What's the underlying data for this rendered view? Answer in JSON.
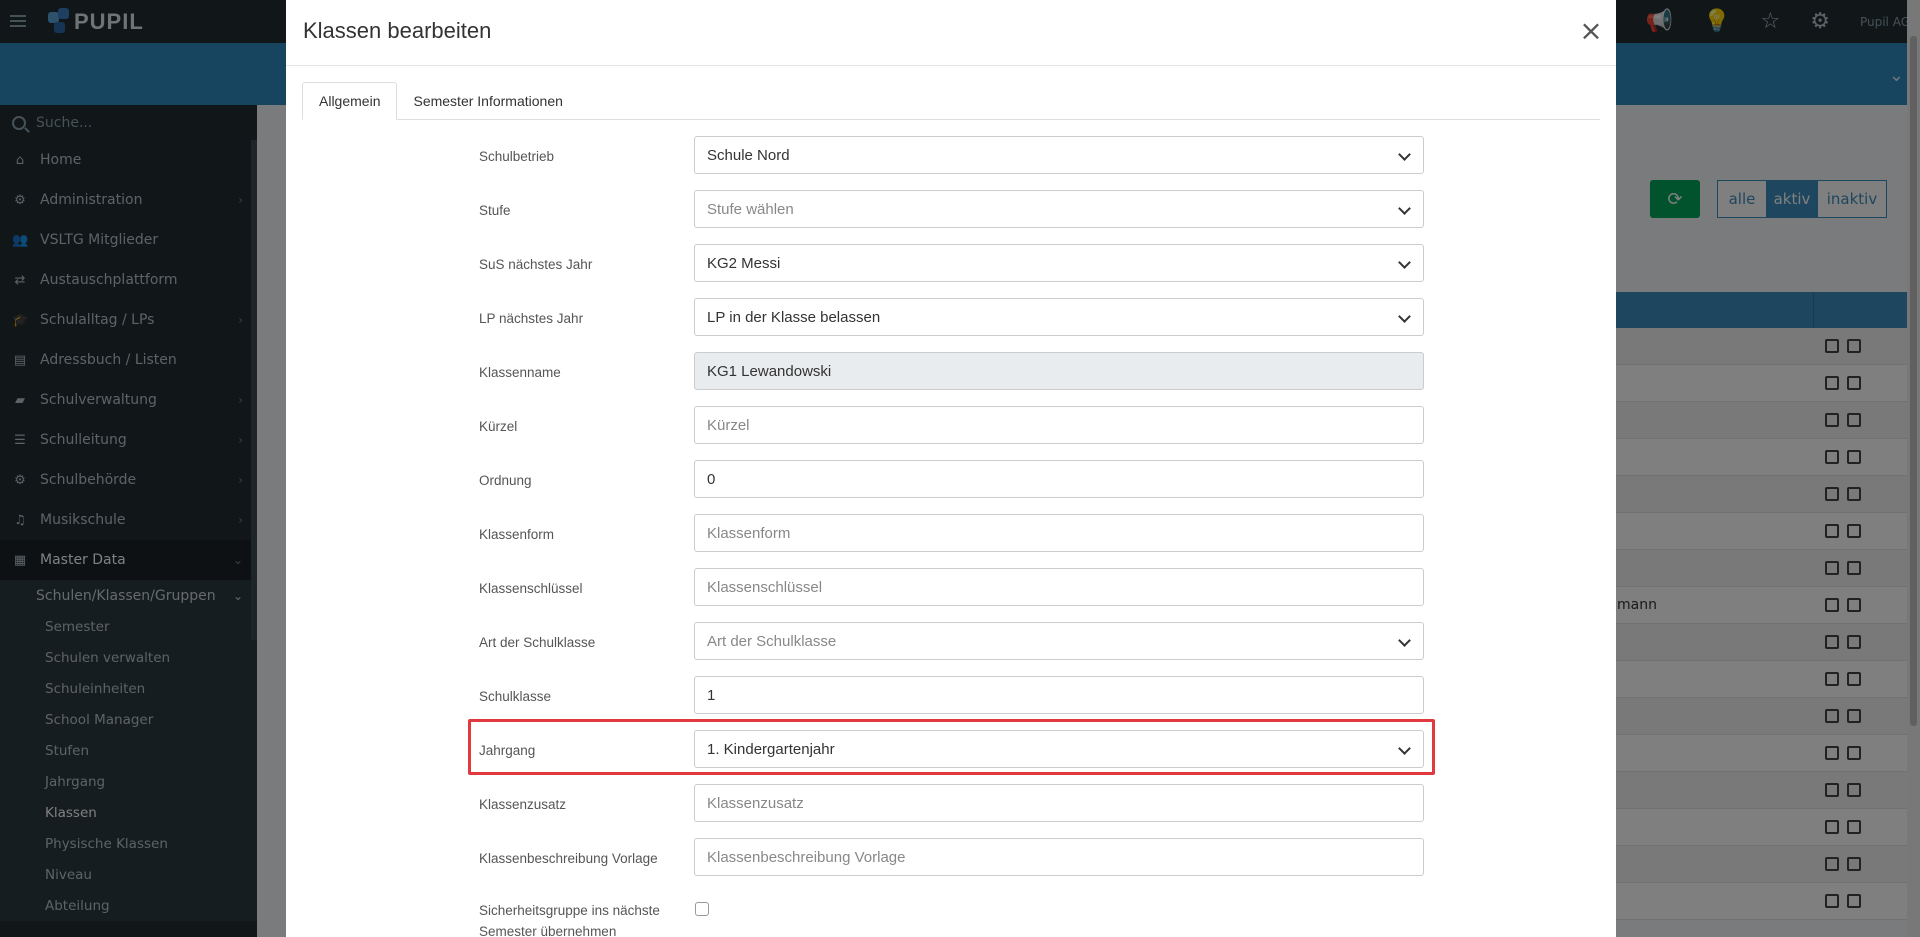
{
  "app": {
    "logo_text": "PUPIL",
    "user": "Pupil AG"
  },
  "sidebar": {
    "search_placeholder": "Suche...",
    "items": [
      {
        "label": "Home",
        "icon": "home-icon"
      },
      {
        "label": "Administration",
        "icon": "gears-icon"
      },
      {
        "label": "VSLTG Mitglieder",
        "icon": "users-icon"
      },
      {
        "label": "Austauschplattform",
        "icon": "exchange-icon"
      },
      {
        "label": "Schulalltag / LPs",
        "icon": "graduation-cap-icon"
      },
      {
        "label": "Adressbuch / Listen",
        "icon": "address-card-icon"
      },
      {
        "label": "Schulverwaltung",
        "icon": "folder-icon"
      },
      {
        "label": "Schulleitung",
        "icon": "signpost-icon"
      },
      {
        "label": "Schulbehörde",
        "icon": "cog-icon"
      },
      {
        "label": "Musikschule",
        "icon": "music-icon"
      },
      {
        "label": "Master Data",
        "icon": "database-icon"
      }
    ],
    "submenu_head": "Schulen/Klassen/Gruppen",
    "subitems": [
      "Semester",
      "Schulen verwalten",
      "Schuleinheiten",
      "School Manager",
      "Stufen",
      "Jahrgang",
      "Klassen",
      "Physische Klassen",
      "Niveau",
      "Abteilung"
    ]
  },
  "background": {
    "filter_buttons": [
      "alle",
      "aktiv",
      "inaktiv"
    ],
    "row_extra_text": "mann"
  },
  "modal": {
    "title": "Klassen bearbeiten",
    "tabs": [
      "Allgemein",
      "Semester Informationen"
    ],
    "fields": {
      "schulbetrieb": {
        "label": "Schulbetrieb",
        "value": "Schule Nord"
      },
      "stufe": {
        "label": "Stufe",
        "placeholder": "Stufe wählen"
      },
      "sus": {
        "label": "SuS nächstes Jahr",
        "value": "KG2 Messi"
      },
      "lp": {
        "label": "LP nächstes Jahr",
        "value": "LP in der Klasse belassen"
      },
      "klassenname": {
        "label": "Klassenname",
        "value": "KG1 Lewandowski"
      },
      "kuerzel": {
        "label": "Kürzel",
        "placeholder": "Kürzel"
      },
      "ordnung": {
        "label": "Ordnung",
        "value": "0"
      },
      "klassenform": {
        "label": "Klassenform",
        "placeholder": "Klassenform"
      },
      "klassenschluessel": {
        "label": "Klassenschlüssel",
        "placeholder": "Klassenschlüssel"
      },
      "art": {
        "label": "Art der Schulklasse",
        "placeholder": "Art der Schulklasse"
      },
      "schulklasse": {
        "label": "Schulklasse",
        "value": "1"
      },
      "jahrgang": {
        "label": "Jahrgang",
        "value": "1. Kindergartenjahr"
      },
      "klassenzusatz": {
        "label": "Klassenzusatz",
        "placeholder": "Klassenzusatz"
      },
      "beschreibung": {
        "label": "Klassenbeschreibung Vorlage",
        "placeholder": "Klassenbeschreibung Vorlage"
      },
      "sicherheit": {
        "label": "Sicherheitsgruppe ins nächste Semester übernehmen"
      }
    }
  }
}
